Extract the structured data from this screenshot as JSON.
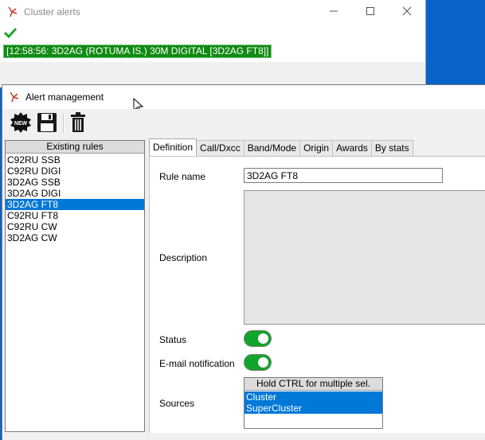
{
  "cluster_window": {
    "title": "Cluster alerts",
    "alert_text": "[12:58:56: 3D2AG (ROTUMA IS.) 30M DIGITAL  [3D2AG FT8]]",
    "icons": [
      "app-icon",
      "check-icon",
      "minimize-icon",
      "maximize-icon",
      "close-icon"
    ]
  },
  "alert_window": {
    "title": "Alert management",
    "toolbar": {
      "icons": [
        "new-rule-icon",
        "save-icon",
        "delete-icon"
      ]
    },
    "rules": {
      "header": "Existing rules",
      "items": [
        "C92RU SSB",
        "C92RU DIGI",
        "3D2AG SSB",
        "3D2AG DIGI",
        "3D2AG FT8",
        "C92RU FT8",
        "C92RU CW",
        "3D2AG CW"
      ],
      "selected": "3D2AG FT8"
    },
    "tabs": [
      "Definition",
      "Call/Dxcc",
      "Band/Mode",
      "Origin",
      "Awards",
      "By stats"
    ],
    "active_tab": "Definition",
    "definition": {
      "rule_name_label": "Rule name",
      "rule_name_value": "3D2AG FT8",
      "description_label": "Description",
      "description_value": "",
      "status_label": "Status",
      "status_on": true,
      "email_label": "E-mail notification",
      "email_on": true,
      "sources_label": "Sources",
      "sources_header": "Hold CTRL for multiple sel.",
      "sources": [
        "Cluster",
        "SuperCluster"
      ]
    }
  },
  "colors": {
    "accent": "#0078d7",
    "alert_bg": "#118a11",
    "toggle_on": "#11a52a",
    "desktop": "#0a64c8"
  }
}
